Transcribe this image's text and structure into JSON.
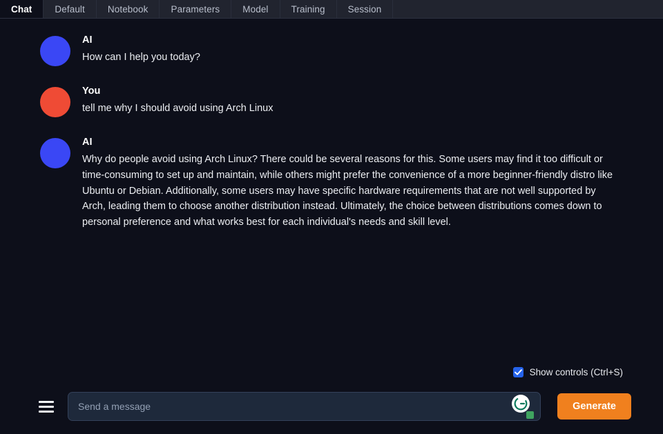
{
  "window": {
    "background_color": "#0d0f1a",
    "accent_color": "#f0801e"
  },
  "tabs": [
    {
      "label": "Chat",
      "active": true
    },
    {
      "label": "Default",
      "active": false
    },
    {
      "label": "Notebook",
      "active": false
    },
    {
      "label": "Parameters",
      "active": false
    },
    {
      "label": "Model",
      "active": false
    },
    {
      "label": "Training",
      "active": false
    },
    {
      "label": "Session",
      "active": false
    }
  ],
  "chat": {
    "messages": [
      {
        "author": "AI",
        "role": "assistant",
        "avatar_color": "#3a47f5",
        "text": "How can I help you today?"
      },
      {
        "author": "You",
        "role": "user",
        "avatar_color": "#ef4b35",
        "text": "tell me why I should avoid using Arch Linux"
      },
      {
        "author": "AI",
        "role": "assistant",
        "avatar_color": "#3a47f5",
        "text": "Why do people avoid using Arch Linux? There could be several reasons for this. Some users may find it too difficult or time-consuming to set up and maintain, while others might prefer the convenience of a more beginner-friendly distro like Ubuntu or Debian. Additionally, some users may have specific hardware requirements that are not well supported by Arch, leading them to choose another distribution instead. Ultimately, the choice between distributions comes down to personal preference and what works best for each individual's needs and skill level."
      }
    ]
  },
  "bottom_bar": {
    "show_controls_label": "Show controls (Ctrl+S)",
    "show_controls_checked": true,
    "menu_icon": "hamburger-menu-icon",
    "input_placeholder": "Send a message",
    "input_value": "",
    "grammarly_icon": "grammarly-logo-icon",
    "grammarly_status_color": "#3fa35f",
    "generate_label": "Generate"
  }
}
